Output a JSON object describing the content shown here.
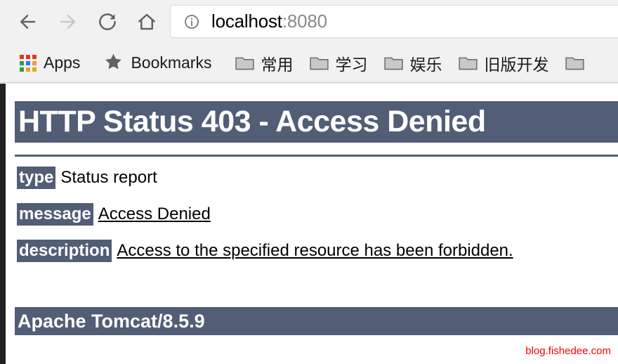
{
  "browser": {
    "nav": {
      "back_icon": "arrow-left-icon",
      "forward_icon": "arrow-right-icon",
      "reload_icon": "reload-icon",
      "home_icon": "home-icon"
    },
    "omnibox": {
      "site_info_icon": "info-circle-icon",
      "url_host": "localhost",
      "url_port": ":8080",
      "full_url": "localhost:8080"
    },
    "bookmarks_bar": {
      "apps": {
        "icon": "apps-grid-icon",
        "label": "Apps",
        "grid_colors": [
          "#ea3323",
          "#ea3323",
          "#ea3323",
          "#2a9d4e",
          "#2b7de9",
          "#f0a024",
          "#2a9d4e",
          "#f0a024",
          "#f0a024"
        ]
      },
      "bookmarks": {
        "icon": "star-icon",
        "label": "Bookmarks"
      },
      "folders": [
        {
          "icon": "folder-icon",
          "label": "常用"
        },
        {
          "icon": "folder-icon",
          "label": "学习"
        },
        {
          "icon": "folder-icon",
          "label": "娱乐"
        },
        {
          "icon": "folder-icon",
          "label": "旧版开发"
        },
        {
          "icon": "folder-icon",
          "label": ""
        }
      ]
    }
  },
  "page": {
    "status_banner": "HTTP Status 403 - Access Denied",
    "rows": [
      {
        "label": "type",
        "value": "Status report",
        "underlined": false
      },
      {
        "label": "message",
        "value": "Access Denied",
        "underlined": true
      },
      {
        "label": "description",
        "value": "Access to the specified resource has been forbidden.",
        "underlined": true
      }
    ],
    "footer_banner": "Apache Tomcat/8.5.9",
    "watermark": "blog.fishedee.com",
    "colors": {
      "banner": "#525d76",
      "watermark": "#ff0000"
    }
  }
}
